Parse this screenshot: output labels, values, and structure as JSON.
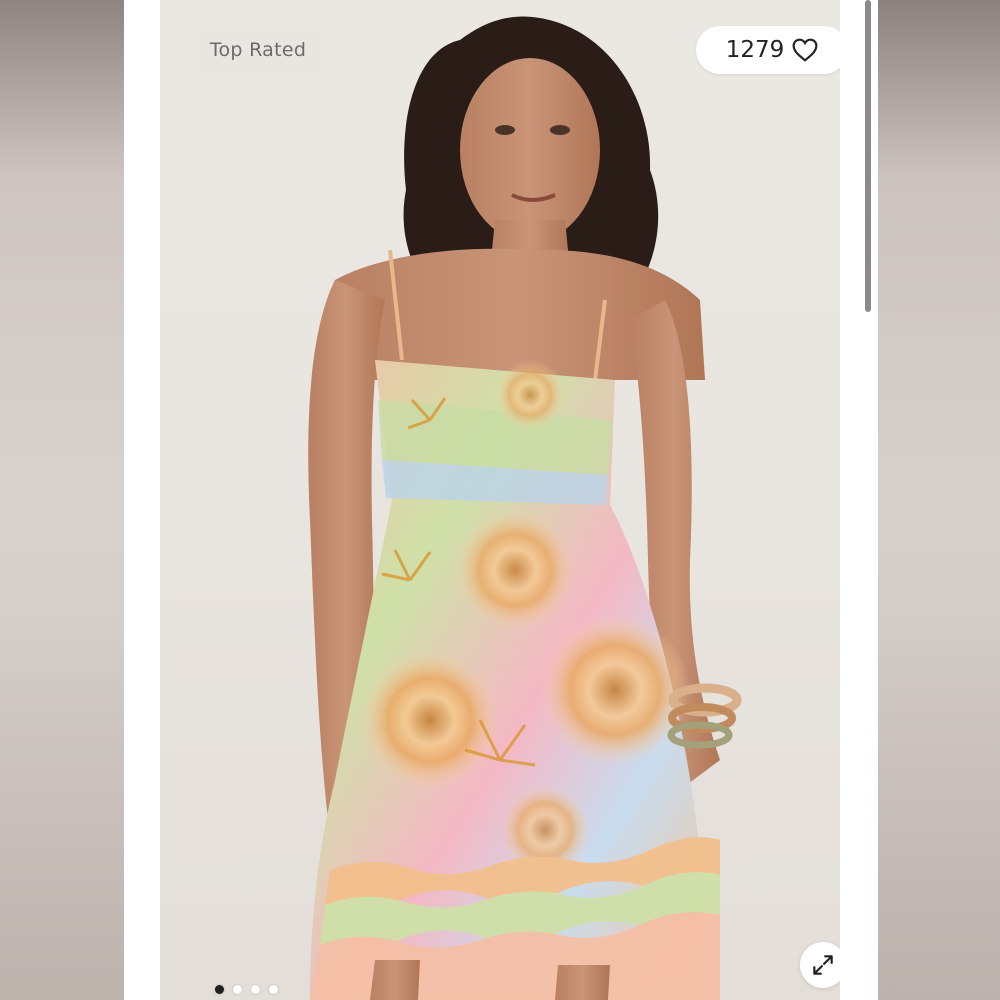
{
  "gallery": {
    "badge_label": "Top Rated",
    "like_count": "1279",
    "image_count": 4,
    "active_index": 0,
    "icons": {
      "like": "heart-outline-icon",
      "expand": "expand-arrows-icon"
    },
    "colors": {
      "accent": "#ffffff",
      "active_dot": "#1f1f1f",
      "print_pink": "#f3b7b0",
      "print_green": "#c8dca1",
      "print_gold": "#d99a3c",
      "print_blue": "#bcd3e6"
    }
  }
}
